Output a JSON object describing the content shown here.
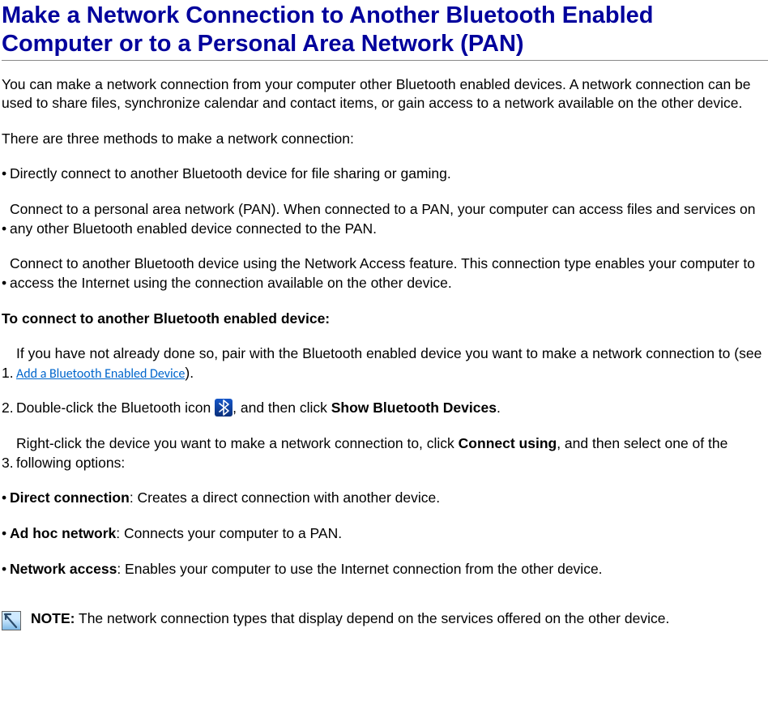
{
  "title": "Make a Network Connection to Another Bluetooth Enabled Computer or to a Personal Area Network (PAN)",
  "intro1": "You can make a network connection from your computer other Bluetooth enabled devices. A network connection can be used to share files, synchronize calendar and contact items, or gain access to a network available on the other device.",
  "intro2": "There are three methods to make a network connection:",
  "bullet_marker": "•",
  "methods": [
    "Directly connect to another Bluetooth device for file sharing or gaming.",
    "Connect to a personal area network (PAN). When connected to a PAN, your computer can access files and services on any other Bluetooth enabled device connected to the PAN.",
    "Connect to another Bluetooth device using the Network Access feature. This connection type enables your computer to access the Internet using the connection available on the other device."
  ],
  "steps_heading": "To connect to another Bluetooth enabled device:",
  "step1": {
    "num": "1.",
    "before_link": "If you have not already done so, pair with the Bluetooth enabled device you want to make a network connection to (see ",
    "link_text": "Add a Bluetooth Enabled Device",
    "after_link": ")."
  },
  "step2": {
    "num": "2.",
    "before_icon": "Double-click the Bluetooth icon ",
    "after_icon": ", and then click ",
    "bold": "Show Bluetooth Devices",
    "tail": "."
  },
  "step3": {
    "num": "3.",
    "part1": "Right-click the device you want to make a network connection to, click ",
    "bold1": "Connect using",
    "part2": ", and then select one of the following options:"
  },
  "options": [
    {
      "label": "Direct connection",
      "text": ": Creates a direct connection with another device."
    },
    {
      "label": "Ad hoc network",
      "text": ": Connects your computer to a PAN."
    },
    {
      "label": "Network access",
      "text": ": Enables your computer to use the Internet connection from the other device."
    }
  ],
  "note": {
    "label": "NOTE:",
    "text": " The network connection types that display depend on the services offered on the other device."
  }
}
